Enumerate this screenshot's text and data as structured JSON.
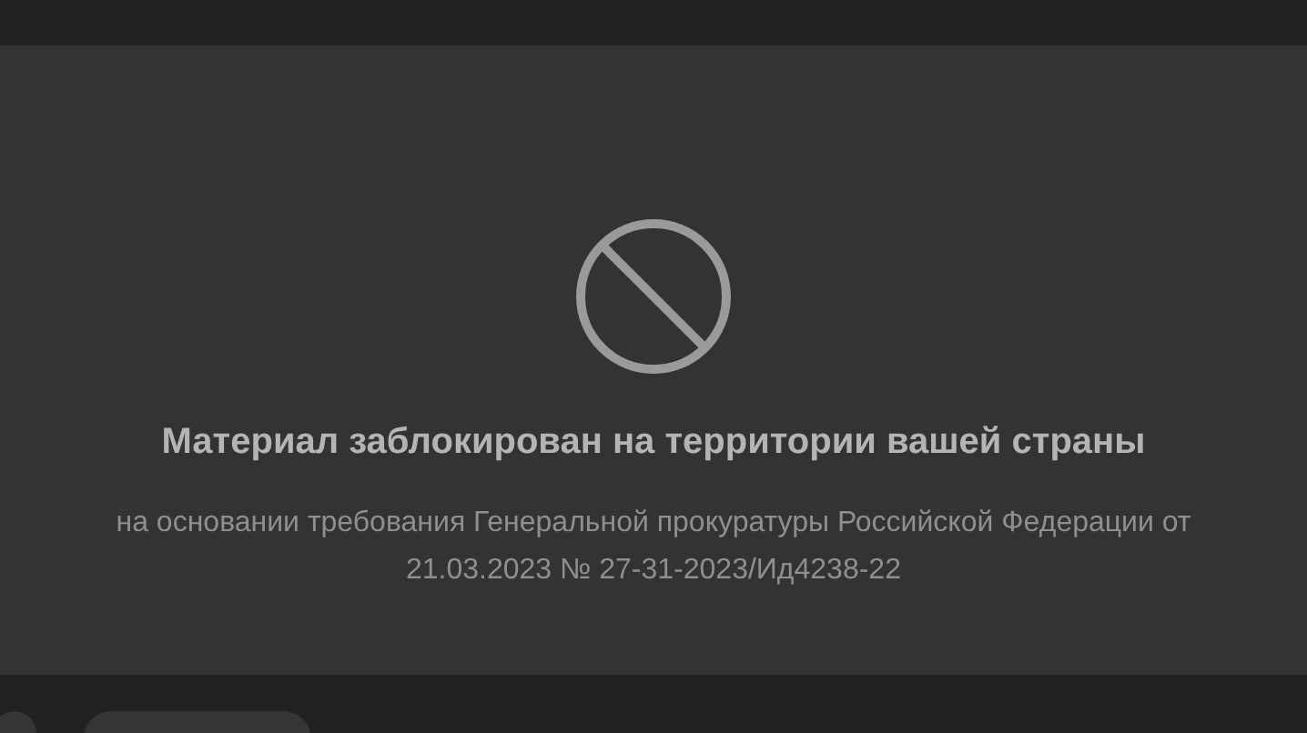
{
  "notice": {
    "title": "Материал заблокирован на территории вашей страны",
    "description": "на основании требования Генеральной прокуратуры Российской Федерации от 21.03.2023 № 27-31-2023/Ид4238-22"
  }
}
